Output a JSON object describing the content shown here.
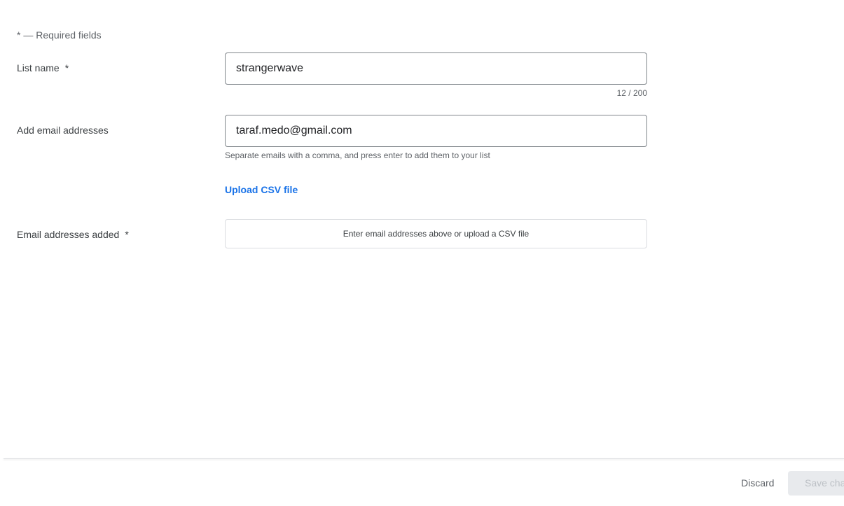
{
  "form": {
    "required_note": "* — Required fields",
    "list_name": {
      "label": "List name",
      "required_mark": "*",
      "value": "strangerwave",
      "counter": "12 / 200"
    },
    "add_emails": {
      "label": "Add email addresses",
      "value": "taraf.medo@gmail.com",
      "helper": "Separate emails with a comma, and press enter to add them to your list",
      "upload_link": "Upload CSV file"
    },
    "emails_added": {
      "label": "Email addresses added",
      "required_mark": "*",
      "empty_state": "Enter email addresses above or upload a CSV file"
    }
  },
  "footer": {
    "discard_label": "Discard",
    "save_label": "Save cha"
  },
  "colors": {
    "link": "#1a73e8",
    "disabled_button_bg": "#e8eaed",
    "disabled_button_text": "#bdc1c6"
  }
}
